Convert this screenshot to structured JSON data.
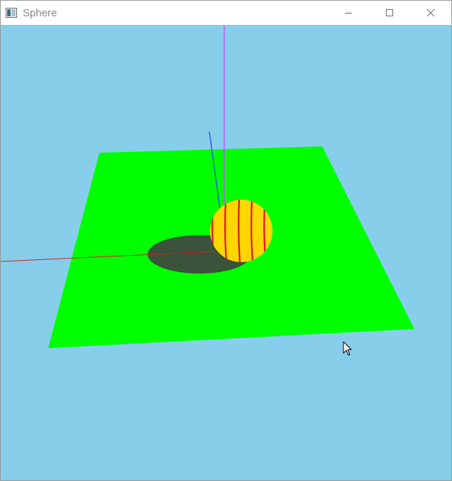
{
  "window": {
    "title": "Sphere",
    "buttons": {
      "minimize": "minimize-icon",
      "maximize": "maximize-icon",
      "close": "close-icon"
    }
  },
  "scene": {
    "background_color": "#87ceeb",
    "plane_color": "#00ff00",
    "shadow_color": "#3a533a",
    "sphere_color": "#ffd700",
    "sphere_stripe_color": "#e01010",
    "axes": {
      "x_color": "#cc2222",
      "y_color": "#cc44ff",
      "z_color": "#1f3fff"
    }
  }
}
